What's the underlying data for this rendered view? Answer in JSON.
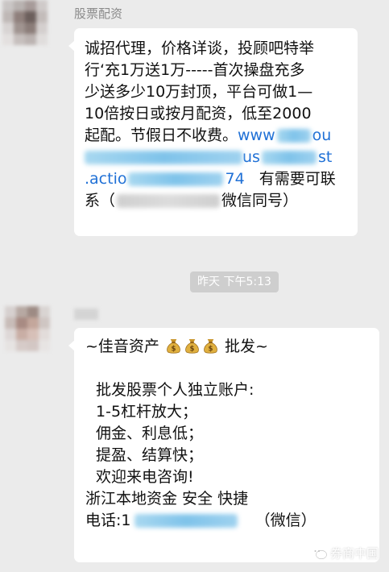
{
  "messages": [
    {
      "sender": "股票配资",
      "lines": {
        "l1": "诚招代理，价格详谈，投顾吧特举",
        "l2": "行‘充1万送1万-----首次操盘充多",
        "l3": "少送多少10万封顶，平台可做1—",
        "l4": "10倍按日或按月配资，低至2000",
        "l5_a": "起配。节假日不收费。",
        "l5_b": "www",
        "l5_c": "ou",
        "l6_a": "us",
        "l6_b": "st",
        "l7_a": ".actio",
        "l7_b": "74",
        "l7_c": "有需要可联",
        "l8_a": "系（",
        "l8_b": "微信同号）"
      }
    },
    {
      "sender": "",
      "lines": {
        "l1_a": "~佳音资产",
        "l1_b": "批发~",
        "l2": "",
        "l3": "批发股票个人独立账户:",
        "l4": "1-5杠杆放大；",
        "l5": "佣金、利息低；",
        "l6": "提盈、结算快；",
        "l7": "欢迎来电咨询!",
        "l8": "浙江本地资金 安全 快捷",
        "l9_a": "电话:1",
        "l9_b": "（微信）"
      }
    }
  ],
  "timestamp": "昨天 下午5:13",
  "watermark": "券商中国",
  "colors": {
    "background": "#ebebeb",
    "bubble": "#ffffff",
    "link": "#1f70d6",
    "timestamp_bg": "#cecece"
  },
  "icons": {
    "emoji": "money-bag-icon",
    "watermark": "wechat-icon"
  }
}
